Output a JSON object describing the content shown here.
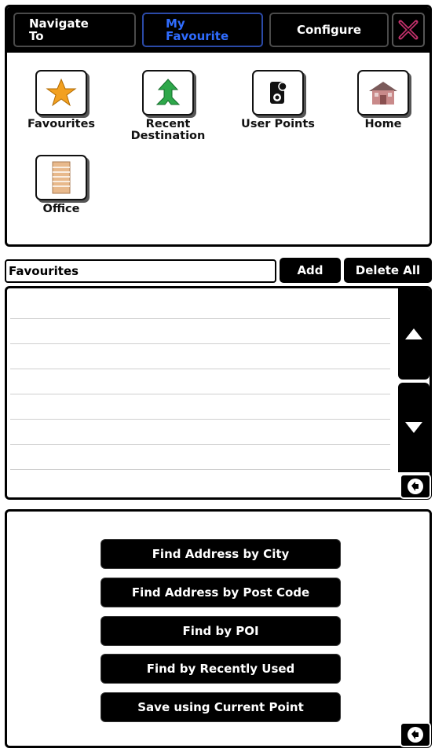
{
  "tabs": {
    "navigate_to": "Navigate\nTo",
    "my_favourite": "My\nFavourite",
    "configure": "Configure",
    "close_icon": "close-icon"
  },
  "favourites": [
    {
      "label": "Favourites",
      "icon": "star-icon"
    },
    {
      "label": "Recent\nDestination",
      "icon": "recent-destination-icon"
    },
    {
      "label": "User Points",
      "icon": "user-points-icon"
    },
    {
      "label": "Home",
      "icon": "home-icon"
    },
    {
      "label": "Office",
      "icon": "office-icon"
    }
  ],
  "list": {
    "field_value": "Favourites",
    "add_label": "Add",
    "delete_all_label": "Delete All"
  },
  "menu": {
    "find_by_city": "Find Address by City",
    "find_by_post_code": "Find Address by Post Code",
    "find_by_poi": "Find by POI",
    "find_by_recently_used": "Find by Recently Used",
    "save_current_point": "Save using Current Point"
  },
  "colors": {
    "active_tab": "#2f6cff",
    "close_x": "#c0306a",
    "star": "#f2a020",
    "arrow": "#2ea84a"
  }
}
